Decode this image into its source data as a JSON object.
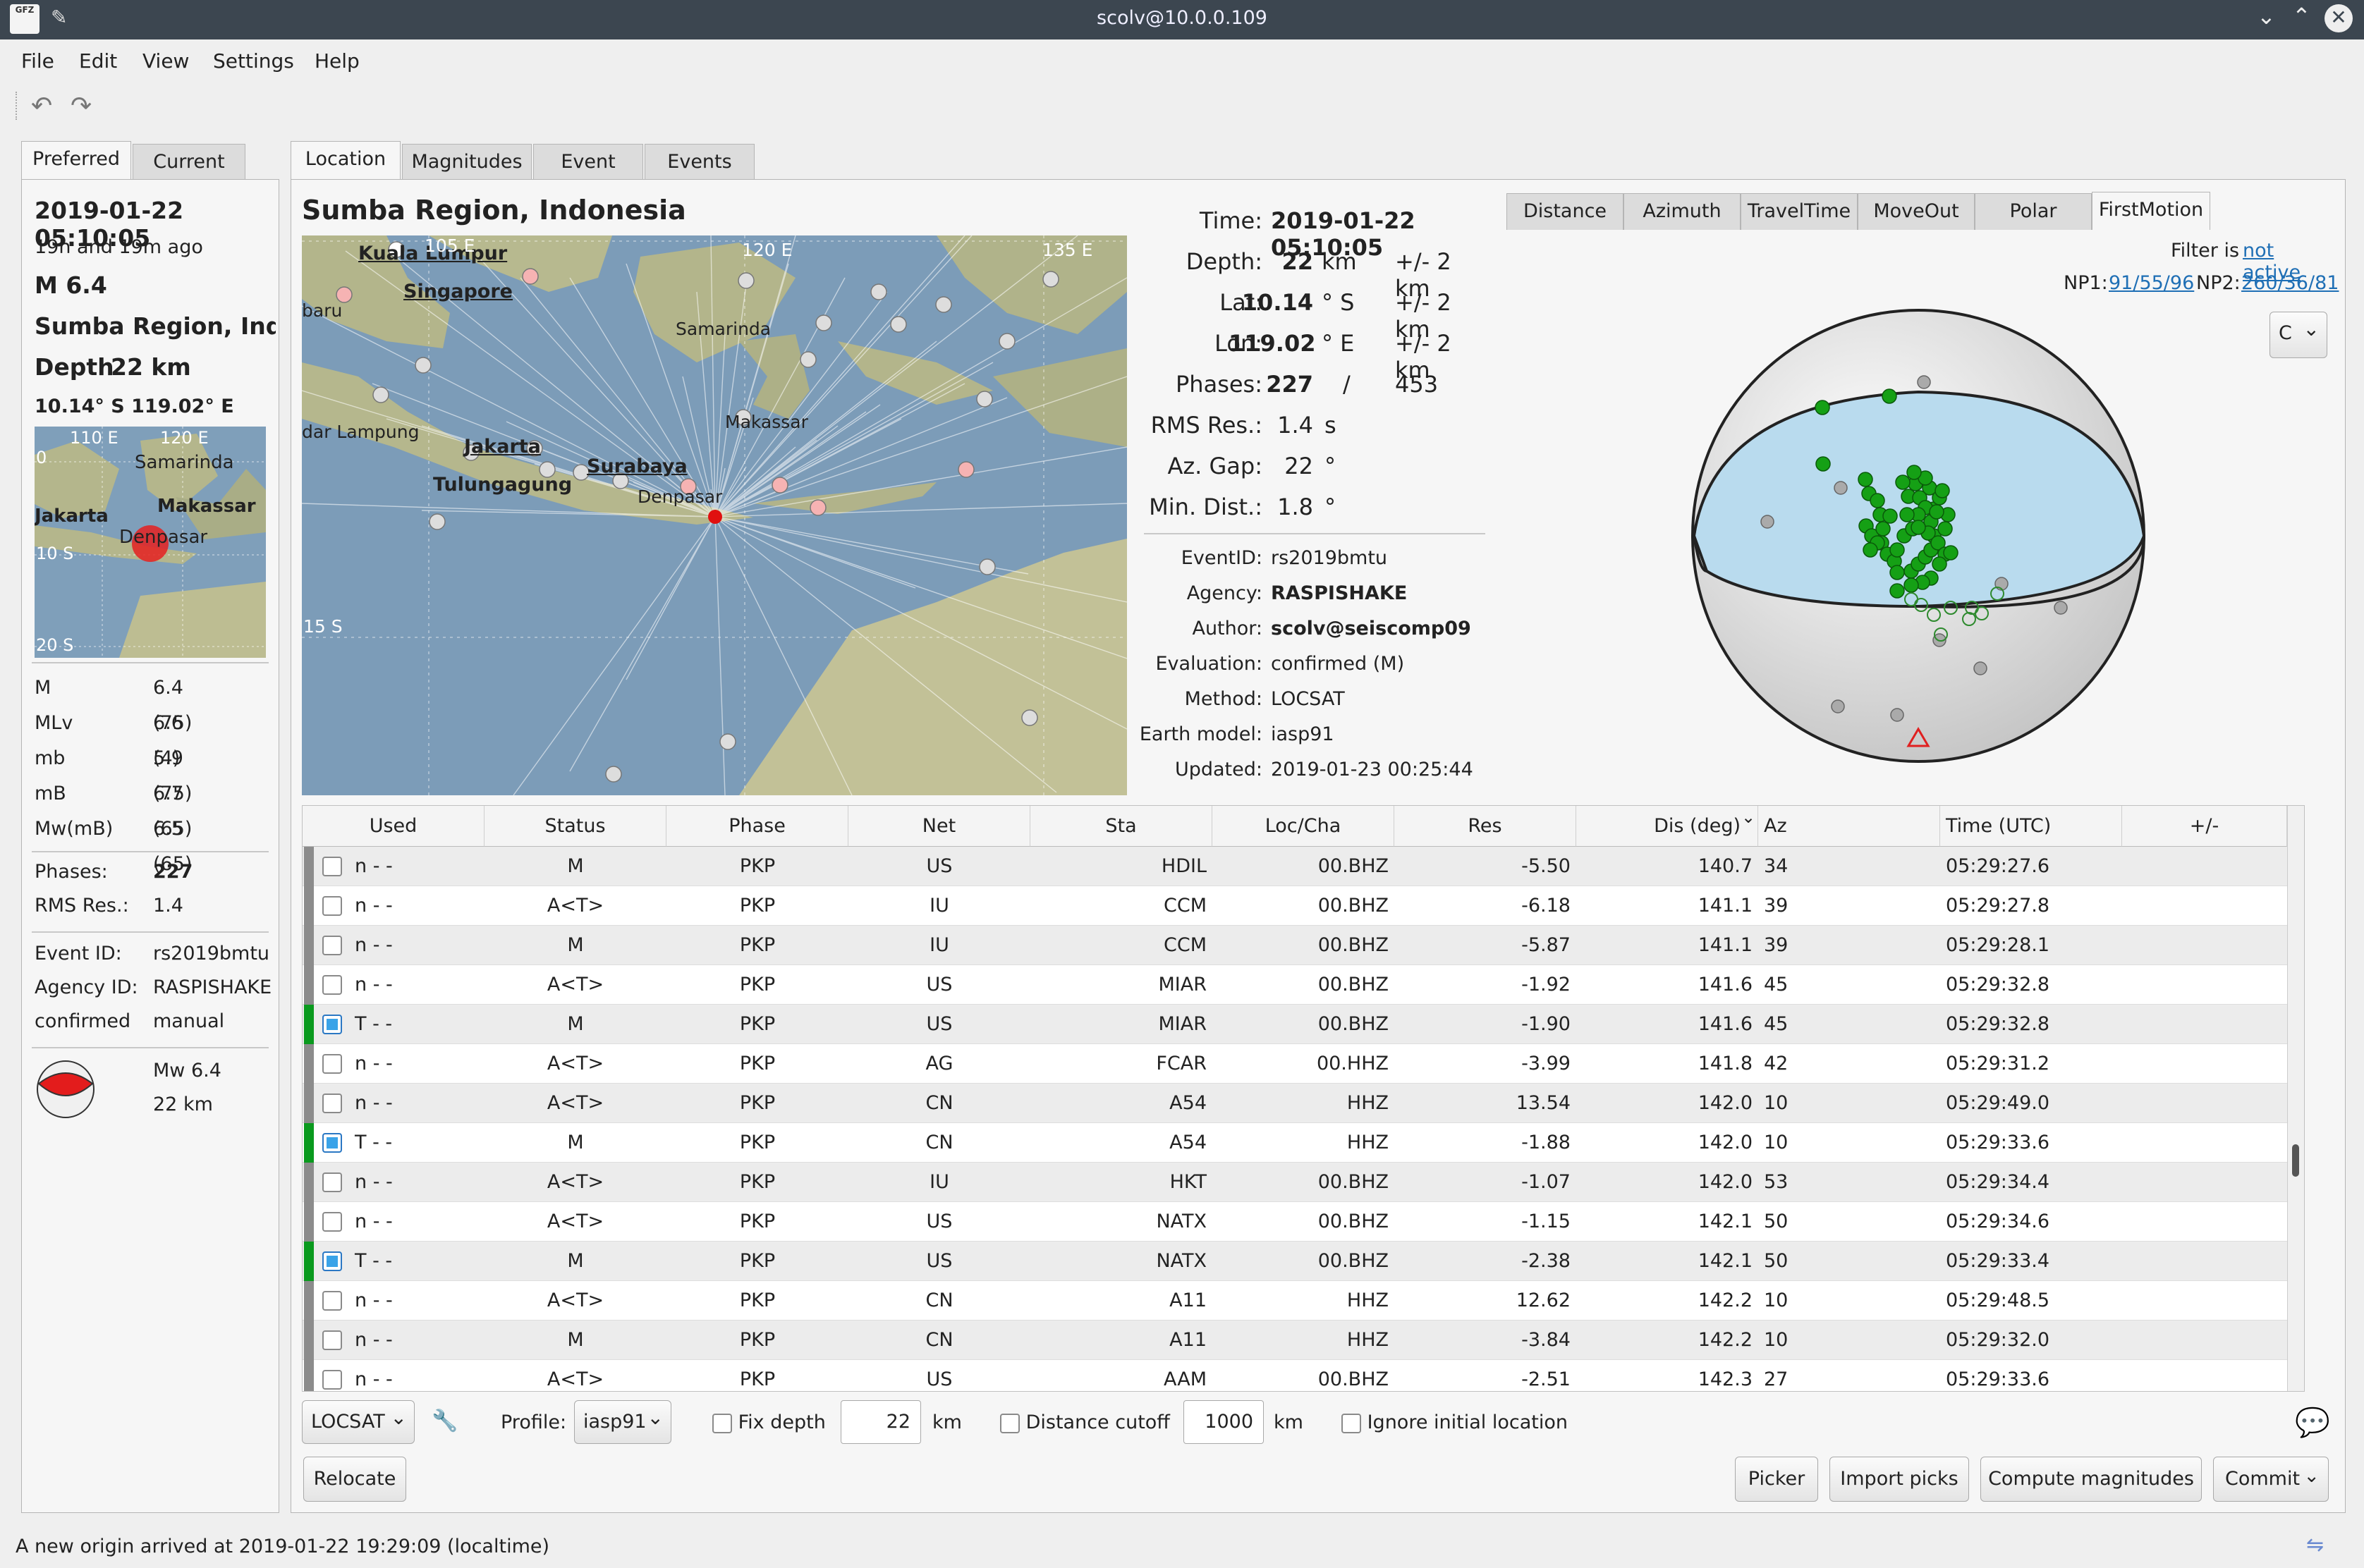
{
  "window": {
    "title": "scolv@10.0.0.109",
    "app_icon_text": "GFZ"
  },
  "menu": [
    "File",
    "Edit",
    "View",
    "Settings",
    "Help"
  ],
  "left_tabs": [
    "Preferred",
    "Current"
  ],
  "summary": {
    "time": "2019-01-22 05:10:05",
    "ago": "19h and 19m ago",
    "mag": "M  6.4",
    "region": "Sumba Region, Indo",
    "depth_label": "Depth",
    "depth": "22 km",
    "coords": "10.14° S  119.02° E",
    "mini_map_labels": [
      "110 E",
      "120 E",
      "Samarinda",
      "Makassar",
      "Jakarta",
      "Denpasar",
      "0",
      "10 S",
      "20 S"
    ],
    "magnitudes": [
      [
        "M",
        "6.4 (75)"
      ],
      [
        "MLv",
        "6.6 (4)"
      ],
      [
        "mb",
        "5.9 (75)"
      ],
      [
        "mB",
        "6.7 (65)"
      ],
      [
        "Mw(mB)",
        "6.5 (65)"
      ]
    ],
    "phases_label": "Phases:",
    "phases": "227",
    "rms_label": "RMS Res.:",
    "rms": "1.4",
    "event_id_label": "Event ID:",
    "event_id": "rs2019bmtu",
    "agency_label": "Agency ID:",
    "agency": "RASPISHAKE",
    "status1": "confirmed",
    "status2": "manual",
    "fm_mag": "Mw 6.4",
    "fm_depth": "22 km"
  },
  "main_tabs": [
    "Location",
    "Magnitudes",
    "Event",
    "Events"
  ],
  "region_title": "Sumba Region, Indonesia",
  "map_labels": {
    "kl": "Kuala Lumpur",
    "sg": "Singapore",
    "baru": "baru",
    "samarinda": "Samarinda",
    "makassar": "Makassar",
    "lampung": "dar Lampung",
    "jakarta": "Jakarta",
    "surabaya": "Surabaya",
    "tulungagung": "Tulungagung",
    "denpasar": "Denpasar",
    "e120": "120 E",
    "e135": "135 E",
    "s15": "15 S",
    "e105": "105 E"
  },
  "origin": {
    "time_l": "Time:",
    "time": "2019-01-22 05:10:05",
    "depth_l": "Depth:",
    "depth": "22",
    "depth_u": "km",
    "depth_e": "+/- 2 km",
    "lat_l": "Lat:",
    "lat": "10.14",
    "lat_u": "° S",
    "lat_e": "+/- 2 km",
    "lon_l": "Lon:",
    "lon": "119.02",
    "lon_u": "° E",
    "lon_e": "+/- 2 km",
    "phases_l": "Phases:",
    "phases_used": "227",
    "phases_slash": "/",
    "phases_total": "453",
    "rms_l": "RMS Res.:",
    "rms": "1.4",
    "rms_u": "s",
    "gap_l": "Az. Gap:",
    "gap": "22",
    "gap_u": "°",
    "mind_l": "Min. Dist.:",
    "mind": "1.8",
    "mind_u": "°",
    "eventid_l": "EventID:",
    "eventid": "rs2019bmtu",
    "agency_l": "Agency:",
    "agency": "RASPISHAKE",
    "author_l": "Author:",
    "author": "scolv@seiscomp09",
    "eval_l": "Evaluation:",
    "eval": "confirmed (M)",
    "method_l": "Method:",
    "method": "LOCSAT",
    "model_l": "Earth model:",
    "model": "iasp91",
    "updated_l": "Updated:",
    "updated": "2019-01-23 00:25:44"
  },
  "plot_tabs": [
    "Distance",
    "Azimuth",
    "TravelTime",
    "MoveOut",
    "Polar",
    "FirstMotion"
  ],
  "filter": {
    "label": "Filter is",
    "link": "not active"
  },
  "np": {
    "np1_l": "NP1:",
    "np1": "91/55/96",
    "np2_l": "NP2:",
    "np2": "260/36/81"
  },
  "combo_c": "C",
  "table": {
    "headers": [
      "Used",
      "Status",
      "Phase",
      "Net",
      "Sta",
      "Loc/Cha",
      "Res",
      "Dis (deg)",
      "Az",
      "Time (UTC)",
      "+/-"
    ],
    "rows": [
      [
        "n  -  -",
        "M",
        "PKP",
        "US",
        "HDIL",
        "00.BHZ",
        "-5.50",
        "140.7",
        "34",
        "05:29:27.6"
      ],
      [
        "n  -  -",
        "A<T>",
        "PKP",
        "IU",
        "CCM",
        "00.BHZ",
        "-6.18",
        "141.1",
        "39",
        "05:29:27.8"
      ],
      [
        "n  -  -",
        "M",
        "PKP",
        "IU",
        "CCM",
        "00.BHZ",
        "-5.87",
        "141.1",
        "39",
        "05:29:28.1"
      ],
      [
        "n  -  -",
        "A<T>",
        "PKP",
        "US",
        "MIAR",
        "00.BHZ",
        "-1.92",
        "141.6",
        "45",
        "05:29:32.8"
      ],
      [
        "T  -  -",
        "M",
        "PKP",
        "US",
        "MIAR",
        "00.BHZ",
        "-1.90",
        "141.6",
        "45",
        "05:29:32.8"
      ],
      [
        "n  -  -",
        "A<T>",
        "PKP",
        "AG",
        "FCAR",
        "00.HHZ",
        "-3.99",
        "141.8",
        "42",
        "05:29:31.2"
      ],
      [
        "n  -  -",
        "A<T>",
        "PKP",
        "CN",
        "A54",
        "HHZ",
        "13.54",
        "142.0",
        "10",
        "05:29:49.0"
      ],
      [
        "T  -  -",
        "M",
        "PKP",
        "CN",
        "A54",
        "HHZ",
        "-1.88",
        "142.0",
        "10",
        "05:29:33.6"
      ],
      [
        "n  -  -",
        "A<T>",
        "PKP",
        "IU",
        "HKT",
        "00.BHZ",
        "-1.07",
        "142.0",
        "53",
        "05:29:34.4"
      ],
      [
        "n  -  -",
        "A<T>",
        "PKP",
        "US",
        "NATX",
        "00.BHZ",
        "-1.15",
        "142.1",
        "50",
        "05:29:34.6"
      ],
      [
        "T  -  -",
        "M",
        "PKP",
        "US",
        "NATX",
        "00.BHZ",
        "-2.38",
        "142.1",
        "50",
        "05:29:33.4"
      ],
      [
        "n  -  -",
        "A<T>",
        "PKP",
        "CN",
        "A11",
        "HHZ",
        "12.62",
        "142.2",
        "10",
        "05:29:48.5"
      ],
      [
        "n  -  -",
        "M",
        "PKP",
        "CN",
        "A11",
        "HHZ",
        "-3.84",
        "142.2",
        "10",
        "05:29:32.0"
      ],
      [
        "n  -  -",
        "A<T>",
        "PKP",
        "US",
        "AAM",
        "00.BHZ",
        "-2.51",
        "142.3",
        "27",
        "05:29:33.6"
      ]
    ]
  },
  "controls": {
    "locator": "LOCSAT",
    "profile_l": "Profile:",
    "profile": "iasp91",
    "fixdepth": "Fix depth",
    "depth_val": "22",
    "km1": "km",
    "distcut": "Distance cutoff",
    "dist_val": "1000",
    "km2": "km",
    "ignore": "Ignore initial location"
  },
  "buttons": {
    "relocate": "Relocate",
    "picker": "Picker",
    "import": "Import picks",
    "compute": "Compute magnitudes",
    "commit": "Commit"
  },
  "status": "A new origin arrived at 2019-01-22 19:29:09 (localtime)"
}
